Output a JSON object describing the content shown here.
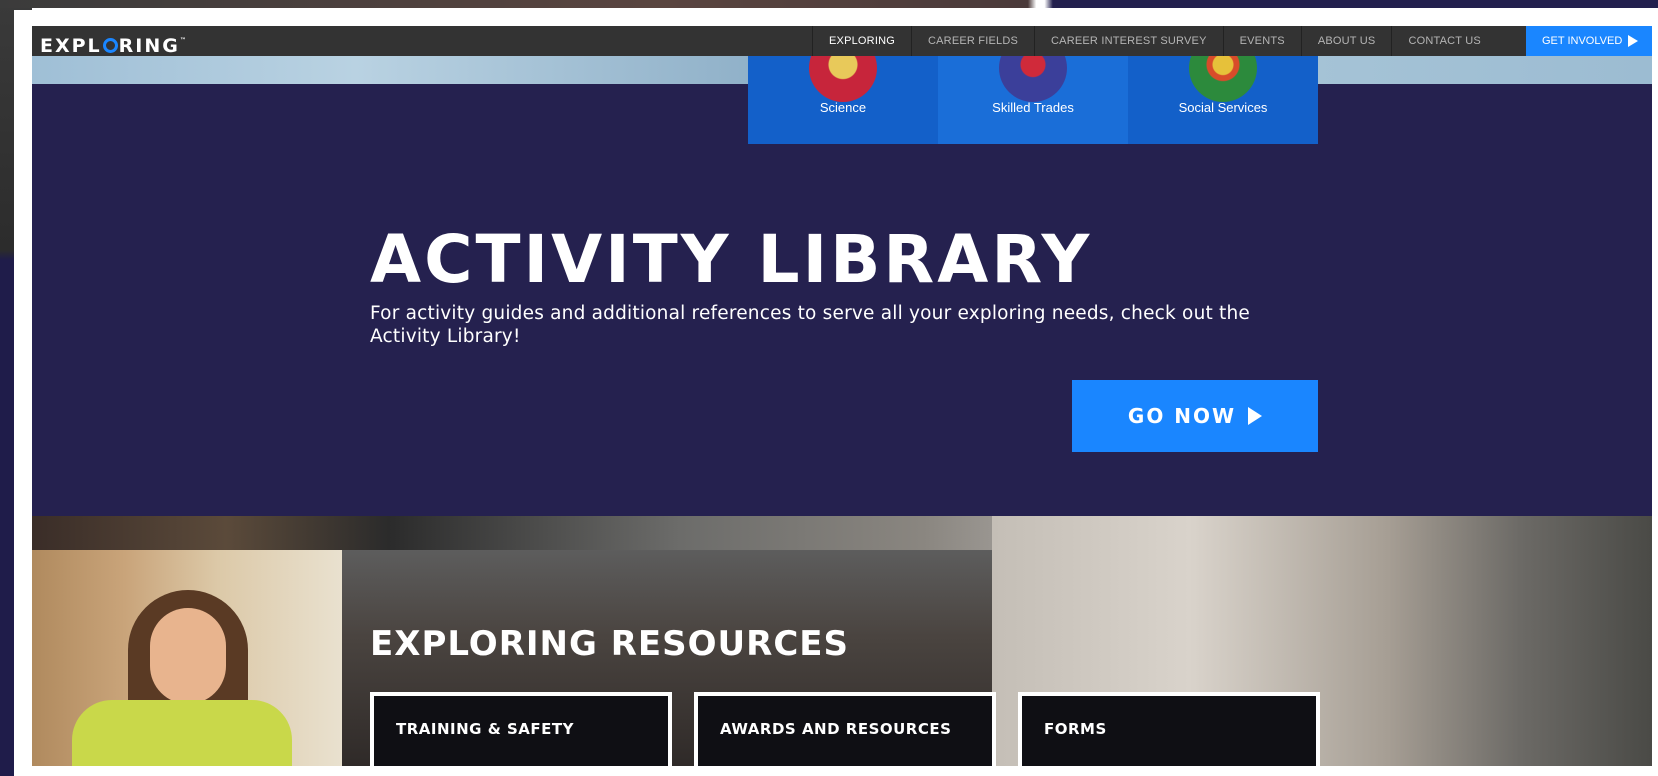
{
  "brand": {
    "logo_left": "EXPL",
    "logo_right": "RING",
    "logo_tm": "™"
  },
  "nav": {
    "items": [
      {
        "label": "EXPLORING"
      },
      {
        "label": "CAREER FIELDS"
      },
      {
        "label": "CAREER INTEREST SURVEY"
      },
      {
        "label": "EVENTS"
      },
      {
        "label": "ABOUT US"
      },
      {
        "label": "CONTACT US"
      }
    ],
    "cta_label": "GET INVOLVED"
  },
  "career_tiles": [
    {
      "label": "Science"
    },
    {
      "label": "Skilled Trades"
    },
    {
      "label": "Social Services"
    }
  ],
  "activity_library": {
    "title": "ACTIVITY LIBRARY",
    "description": "For activity guides and additional references to serve all your exploring needs, check out the Activity Library!",
    "button_label": "GO NOW"
  },
  "resources": {
    "title": "EXPLORING RESOURCES",
    "buttons": [
      {
        "label": "TRAINING & SAFETY"
      },
      {
        "label": "AWARDS AND RESOURCES"
      },
      {
        "label": "FORMS"
      }
    ]
  },
  "colors": {
    "accent": "#1a86ff",
    "hero_bg": "#25214f",
    "nav_bg": "#333333",
    "tile_bg": "#1360c9"
  }
}
